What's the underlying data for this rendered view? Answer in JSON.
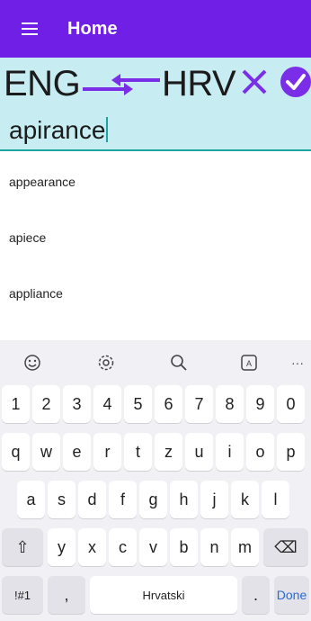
{
  "appbar": {
    "title": "Home",
    "menu_icon": "hamburger-menu-icon",
    "color": "#6f1fe6"
  },
  "languages": {
    "source": "ENG",
    "target": "HRV",
    "swap_icon": "swap-arrows-icon",
    "clear_icon": "close-icon",
    "confirm_icon": "check-circle-icon",
    "accent": "#7a2ee8",
    "bar_color": "#c7edf3"
  },
  "input": {
    "value": "apirance"
  },
  "suggestions": [
    "appearance",
    "apiece",
    "appliance"
  ],
  "keyboard": {
    "toolbar": [
      "emoji-icon",
      "settings-icon",
      "search-icon",
      "translate-icon",
      "more-icon"
    ],
    "more_label": "···",
    "row_numbers": [
      "1",
      "2",
      "3",
      "4",
      "5",
      "6",
      "7",
      "8",
      "9",
      "0"
    ],
    "row1": [
      "q",
      "w",
      "e",
      "r",
      "t",
      "z",
      "u",
      "i",
      "o",
      "p"
    ],
    "row2": [
      "a",
      "s",
      "d",
      "f",
      "g",
      "h",
      "j",
      "k",
      "l"
    ],
    "row3": [
      "y",
      "x",
      "c",
      "v",
      "b",
      "n",
      "m"
    ],
    "shift_label": "⇧",
    "backspace_label": "⌫",
    "symbols_label": "!#1",
    "comma_label": ",",
    "space_label": "Hrvatski",
    "period_label": ".",
    "done_label": "Done"
  }
}
